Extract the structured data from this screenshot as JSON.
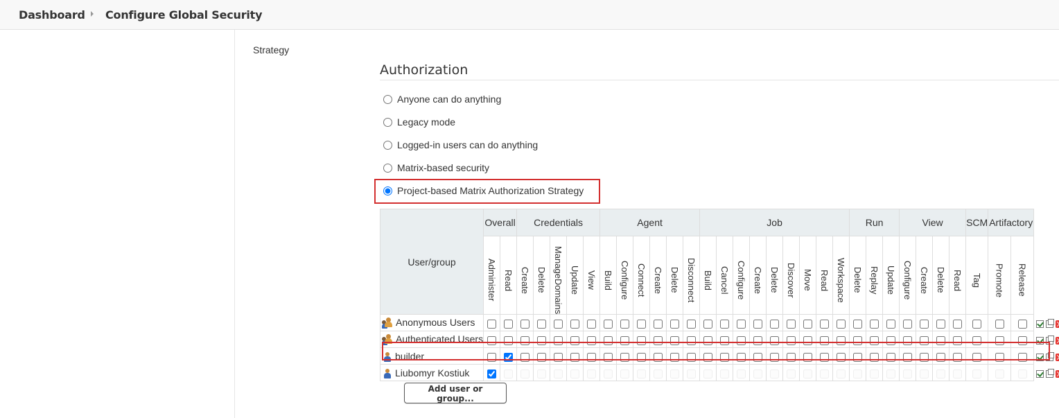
{
  "breadcrumb": {
    "items": [
      "Dashboard",
      "Configure Global Security"
    ]
  },
  "section_label": "Strategy",
  "authorization": {
    "heading": "Authorization",
    "options": [
      {
        "label": "Anyone can do anything",
        "selected": false
      },
      {
        "label": "Legacy mode",
        "selected": false
      },
      {
        "label": "Logged-in users can do anything",
        "selected": false
      },
      {
        "label": "Matrix-based security",
        "selected": false
      },
      {
        "label": "Project-based Matrix Authorization Strategy",
        "selected": true
      }
    ]
  },
  "matrix": {
    "user_group_header": "User/group",
    "groups": [
      {
        "name": "Overall",
        "permissions": [
          "Administer",
          "Read"
        ]
      },
      {
        "name": "Credentials",
        "permissions": [
          "Create",
          "Delete",
          "ManageDomains",
          "Update",
          "View"
        ]
      },
      {
        "name": "Agent",
        "permissions": [
          "Build",
          "Configure",
          "Connect",
          "Create",
          "Delete",
          "Disconnect"
        ]
      },
      {
        "name": "Job",
        "permissions": [
          "Build",
          "Cancel",
          "Configure",
          "Create",
          "Delete",
          "Discover",
          "Move",
          "Read",
          "Workspace"
        ]
      },
      {
        "name": "Run",
        "permissions": [
          "Delete",
          "Replay",
          "Update"
        ]
      },
      {
        "name": "View",
        "permissions": [
          "Configure",
          "Create",
          "Delete",
          "Read"
        ]
      },
      {
        "name": "SCM",
        "permissions": [
          "Tag"
        ]
      },
      {
        "name": "Artifactory",
        "permissions": [
          "Promote",
          "Release"
        ]
      }
    ],
    "rows": [
      {
        "name": "Anonymous Users",
        "type": "group",
        "disabled": false,
        "checked": []
      },
      {
        "name": "Authenticated Users",
        "type": "group",
        "disabled": false,
        "checked": []
      },
      {
        "name": "builder",
        "type": "user",
        "disabled": false,
        "checked": [
          1
        ]
      },
      {
        "name": "Liubomyr Kostiuk",
        "type": "user",
        "disabled": true,
        "checked": [
          0
        ]
      }
    ],
    "add_button": "Add user or group..."
  },
  "icons": {
    "group": "group-icon",
    "user": "user-icon",
    "select_all": "check-all-icon",
    "copy": "copy-icon",
    "remove": "remove-icon"
  },
  "colors": {
    "highlight": "#d32f2f",
    "header_bg": "#e9eef0"
  }
}
